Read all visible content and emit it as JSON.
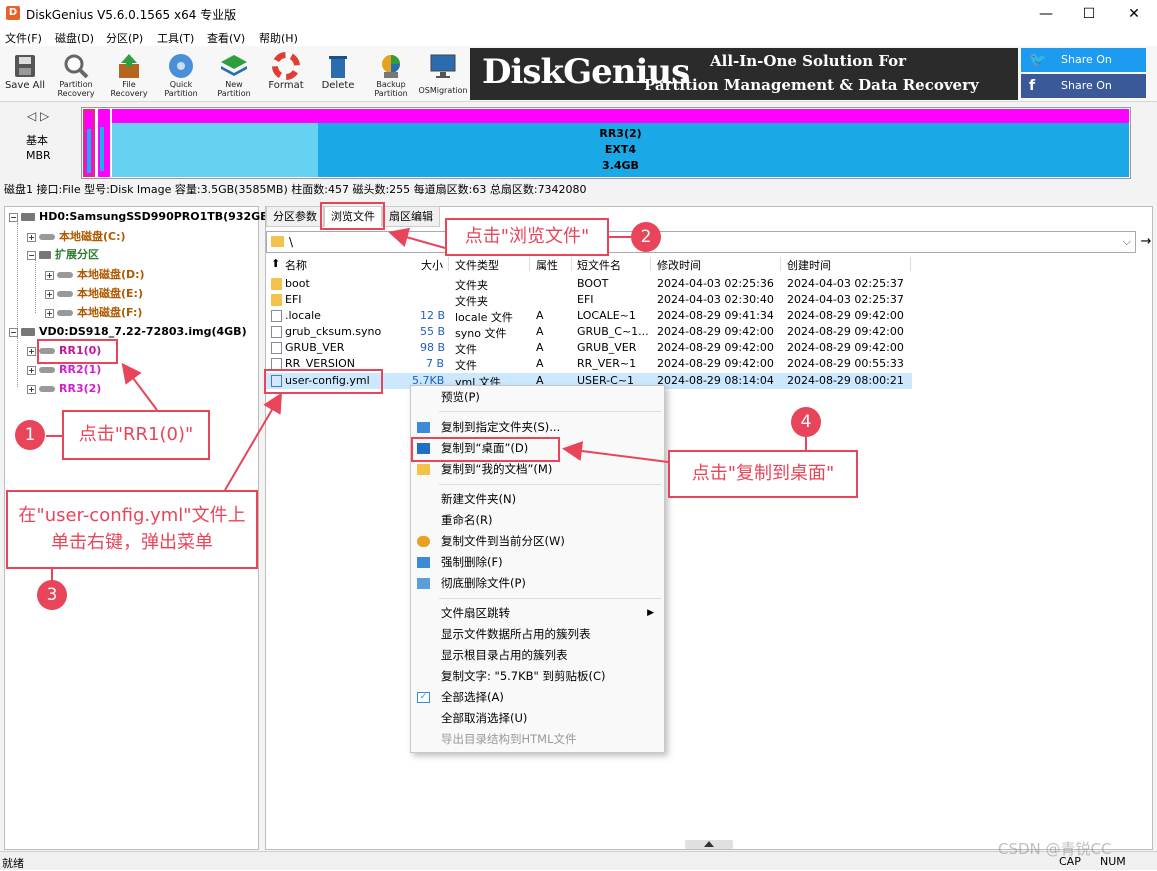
{
  "window": {
    "title": "DiskGenius V5.6.0.1565 x64 专业版",
    "icon": "diskgenius-app-icon",
    "minimize": "—",
    "maximize": "☐",
    "close": "✕"
  },
  "menu": [
    "文件(F)",
    "磁盘(D)",
    "分区(P)",
    "工具(T)",
    "查看(V)",
    "帮助(H)"
  ],
  "toolbar": {
    "save_all": "Save All",
    "partition_recovery": [
      "Partition",
      "Recovery"
    ],
    "file_recovery": [
      "File",
      "Recovery"
    ],
    "quick_partition": [
      "Quick",
      "Partition"
    ],
    "new_partition": [
      "New",
      "Partition"
    ],
    "format": "Format",
    "delete": "Delete",
    "backup_partition": [
      "Backup",
      "Partition"
    ],
    "os_migration": "OSMigration"
  },
  "banner": {
    "logo": "DiskGenius",
    "line1": "All-In-One Solution For",
    "line2": "Partition Management & Data Recovery"
  },
  "social": {
    "twitter": "Share On Twitter",
    "facebook": "Share On Facebook",
    "twitter_color": "#1d9bf0",
    "facebook_color": "#3b5998"
  },
  "diskmap": {
    "nav_arrows": "◁ ▷",
    "type": "基本",
    "scheme": "MBR",
    "partition_name": "RR3(2)",
    "partition_fs": "EXT4",
    "partition_size": "3.4GB"
  },
  "disk_info": "磁盘1 接口:File  型号:Disk Image  容量:3.5GB(3585MB)  柱面数:457  磁头数:255  每道扇区数:63  总扇区数:7342080",
  "tree": {
    "hd0": "HD0:SamsungSSD990PRO1TB(932GB",
    "c": "本地磁盘(C:)",
    "ext": "扩展分区",
    "d": "本地磁盘(D:)",
    "e": "本地磁盘(E:)",
    "f": "本地磁盘(F:)",
    "vd0": "VD0:DS918_7.22-72803.img(4GB)",
    "rr1": "RR1(0)",
    "rr2": "RR2(1)",
    "rr3": "RR3(2)"
  },
  "tabs": [
    "分区参数",
    "浏览文件",
    "扇区编辑"
  ],
  "path": "\\",
  "columns": {
    "name": "名称",
    "size": "大小",
    "type": "文件类型",
    "attr": "属性",
    "short": "短文件名",
    "modified": "修改时间",
    "created": "创建时间"
  },
  "files": [
    {
      "name": "boot",
      "size": "",
      "type": "文件夹",
      "attr": "",
      "short": "BOOT",
      "modified": "2024-04-03 02:25:36",
      "created": "2024-04-03 02:25:37"
    },
    {
      "name": "EFI",
      "size": "",
      "type": "文件夹",
      "attr": "",
      "short": "EFI",
      "modified": "2024-04-03 02:30:40",
      "created": "2024-04-03 02:25:37"
    },
    {
      "name": ".locale",
      "size": "12 B",
      "type": "locale 文件",
      "attr": "A",
      "short": "LOCALE~1",
      "modified": "2024-08-29 09:41:34",
      "created": "2024-08-29 09:42:00"
    },
    {
      "name": "grub_cksum.syno",
      "size": "55 B",
      "type": "syno 文件",
      "attr": "A",
      "short": "GRUB_C~1...",
      "modified": "2024-08-29 09:42:00",
      "created": "2024-08-29 09:42:00"
    },
    {
      "name": "GRUB_VER",
      "size": "98 B",
      "type": "文件",
      "attr": "A",
      "short": "GRUB_VER",
      "modified": "2024-08-29 09:42:00",
      "created": "2024-08-29 09:42:00"
    },
    {
      "name": "RR_VERSION",
      "size": "7 B",
      "type": "文件",
      "attr": "A",
      "short": "RR_VER~1",
      "modified": "2024-08-29 09:42:00",
      "created": "2024-08-29 00:55:33"
    },
    {
      "name": "user-config.yml",
      "size": "5.7KB",
      "type": "yml 文件",
      "attr": "A",
      "short": "USER-C~1",
      "modified": "2024-08-29 08:14:04",
      "created": "2024-08-29 08:00:21"
    }
  ],
  "context_menu": [
    "预览(P)",
    "复制到指定文件夹(S)...",
    "复制到“桌面”(D)",
    "复制到“我的文档”(M)",
    "新建文件夹(N)",
    "重命名(R)",
    "复制文件到当前分区(W)",
    "强制删除(F)",
    "彻底删除文件(P)",
    "文件扇区跳转",
    "显示文件数据所占用的簇列表",
    "显示根目录占用的簇列表",
    "复制文字: \"5.7KB\" 到剪贴板(C)",
    "全部选择(A)",
    "全部取消选择(U)",
    "导出目录结构到HTML文件"
  ],
  "annotations": {
    "step1": "点击\"RR1(0)\"",
    "step2": "点击\"浏览文件\"",
    "step3": "在\"user-config.yml\"文件上单击右键，弹出菜单",
    "step4": "点击\"复制到桌面\"",
    "n1": "1",
    "n2": "2",
    "n3": "3",
    "n4": "4",
    "accent": "#e8455a"
  },
  "status": {
    "left": "就绪",
    "cap": "CAP",
    "num": "NUM"
  },
  "watermark": "CSDN @青锐CC"
}
